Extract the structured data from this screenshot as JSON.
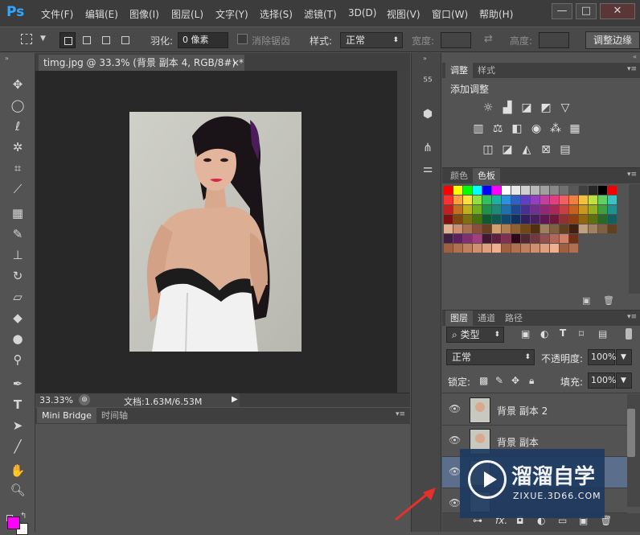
{
  "app": {
    "logo": "Ps"
  },
  "menu": [
    "文件(F)",
    "编辑(E)",
    "图像(I)",
    "图层(L)",
    "文字(Y)",
    "选择(S)",
    "滤镜(T)",
    "3D(D)",
    "视图(V)",
    "窗口(W)",
    "帮助(H)"
  ],
  "window_controls": {
    "minimize": "—",
    "maximize": "□",
    "close": "✕"
  },
  "options": {
    "feather_label": "羽化:",
    "feather_value": "0 像素",
    "antialias_label": "消除锯齿",
    "style_label": "样式:",
    "style_value": "正常",
    "width_label": "宽度:",
    "height_label": "高度:",
    "refine_edge": "调整边缘"
  },
  "document": {
    "tab_title": "timg.jpg @ 33.3% (背景 副本 4, RGB/8#) *",
    "tab_close": "×",
    "zoom": "33.33%",
    "doc_size": "文档:1.63M/6.53M"
  },
  "bottom_panel": {
    "tabs": [
      "Mini Bridge",
      "时间轴"
    ]
  },
  "adjustments_panel": {
    "tabs": [
      "调整",
      "样式"
    ],
    "title": "添加调整"
  },
  "color_panel": {
    "tabs": [
      "颜色",
      "色板"
    ]
  },
  "layers_panel": {
    "tabs": [
      "图层",
      "通道",
      "路径"
    ],
    "filter_label": "类型",
    "blend_mode": "正常",
    "opacity_label": "不透明度:",
    "opacity_value": "100%",
    "lock_label": "锁定:",
    "fill_label": "填充:",
    "fill_value": "100%",
    "layers": [
      {
        "name": "背景 副本 2",
        "selected": false
      },
      {
        "name": "背景 副本",
        "selected": false
      },
      {
        "name": "",
        "selected": true
      },
      {
        "name": "",
        "selected": false
      }
    ]
  },
  "watermark": {
    "title": "溜溜自学",
    "url": "ZIXUE.3D66.COM"
  },
  "colors": {
    "foreground": "#ff00ff",
    "background": "#ffffff",
    "accent_selected": "#5b6f8c",
    "watermark_bg": "#1e3a5f"
  }
}
